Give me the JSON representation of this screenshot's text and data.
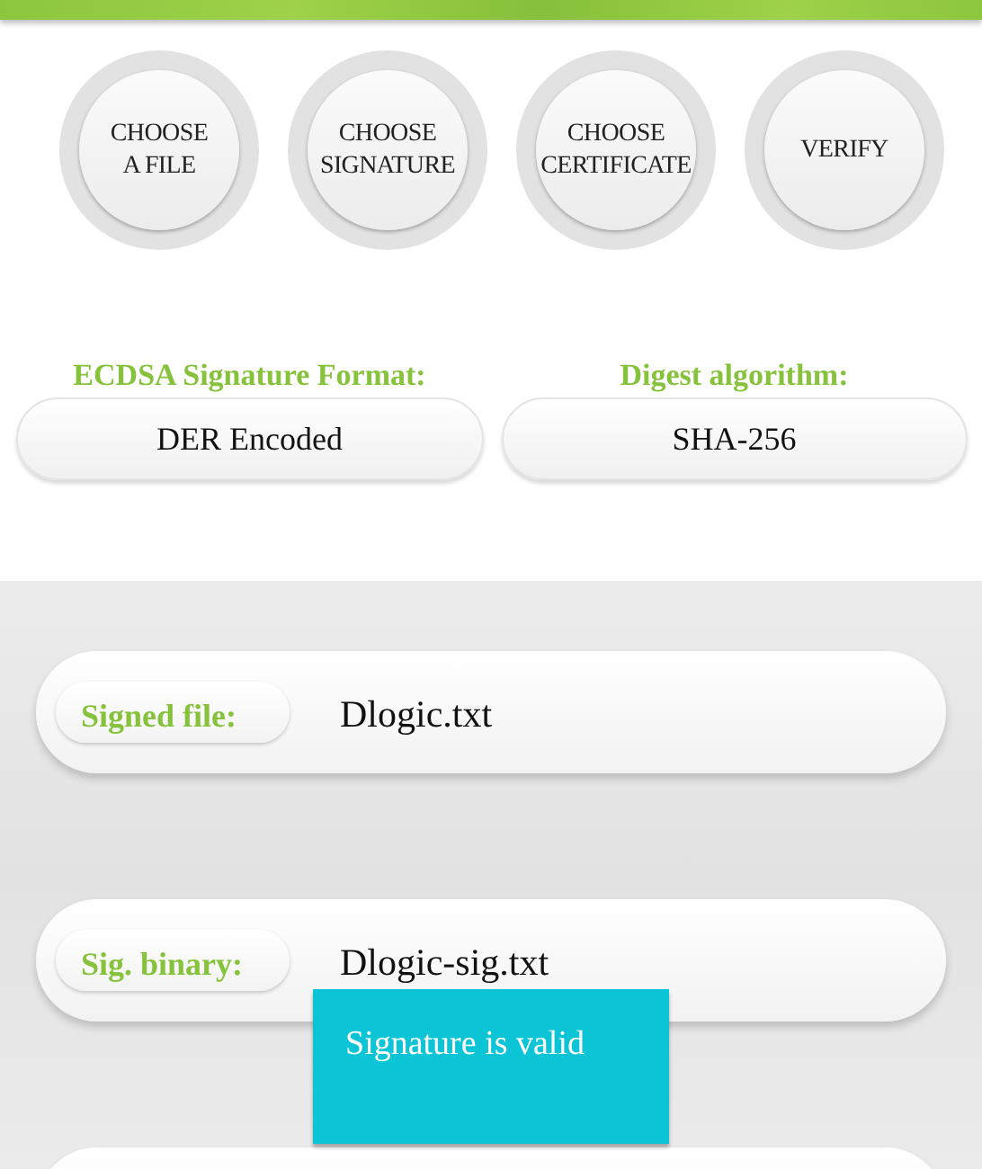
{
  "actions": [
    {
      "label": "CHOOSE\nA FILE"
    },
    {
      "label": "CHOOSE\nSIGNATURE"
    },
    {
      "label": "CHOOSE\nCERTIFICATE"
    },
    {
      "label": "VERIFY"
    }
  ],
  "options": [
    {
      "label": "ECDSA Signature Format:",
      "value": "DER Encoded"
    },
    {
      "label": "Digest algorithm:",
      "value": "SHA-256"
    }
  ],
  "files": [
    {
      "label": "Signed file:",
      "value": "Dlogic.txt"
    },
    {
      "label": "Sig. binary:",
      "value": "Dlogic-sig.txt"
    }
  ],
  "toast": {
    "message": "Signature is valid"
  }
}
